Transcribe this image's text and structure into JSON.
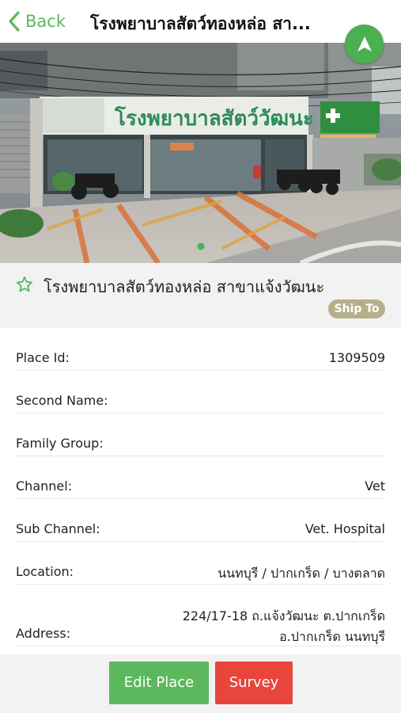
{
  "header": {
    "back_label": "Back",
    "title": "โรงพยาบาลสัตว์ทองหล่อ สา..."
  },
  "place": {
    "name": "โรงพยาบาลสัตว์ทองหล่อ สาขาแจ้งวัฒนะ",
    "badge": "Ship To",
    "photo_sign_text": "โรงพยาบาลสัตว์วัฒนะ"
  },
  "details": [
    {
      "label": "Place Id:",
      "value": "1309509"
    },
    {
      "label": "Second Name:",
      "value": ""
    },
    {
      "label": "Family Group:",
      "value": ""
    },
    {
      "label": "Channel:",
      "value": "Vet"
    },
    {
      "label": "Sub Channel:",
      "value": "Vet. Hospital"
    },
    {
      "label": "Location:",
      "value": "นนทบุรี / ปากเกร็ด / บางตลาด"
    },
    {
      "label": "Address:",
      "value_line1": "224/17-18 ถ.แจ้งวัฒนะ ต.ปากเกร็ด",
      "value_line2": "อ.ปากเกร็ด นนทบุรี"
    }
  ],
  "actions": {
    "edit_label": "Edit Place",
    "survey_label": "Survey"
  },
  "colors": {
    "accent_green": "#5cb85c",
    "danger_red": "#e8453c",
    "badge_olive": "#b5b08a"
  },
  "icons": {
    "back": "chevron-left-icon",
    "navigate": "navigation-arrow-icon",
    "favorite": "star-outline-icon"
  }
}
